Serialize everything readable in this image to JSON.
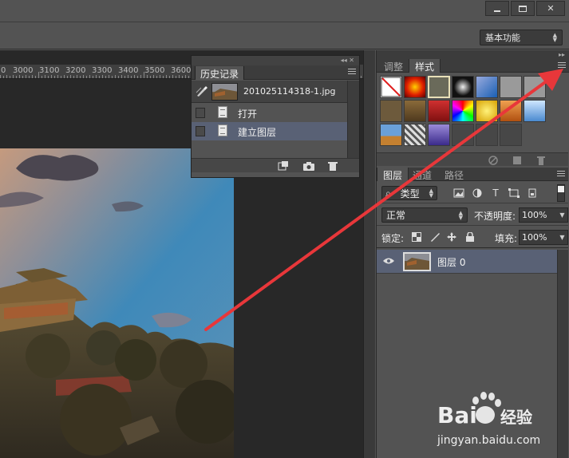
{
  "window": {
    "minimize_glyph": "minimize-icon",
    "maximize_glyph": "restore-icon",
    "close_label": "✕"
  },
  "optionsbar": {
    "workspace": "基本功能"
  },
  "ruler": {
    "labels": [
      "0",
      "3000",
      "3100",
      "3200",
      "3300",
      "3400",
      "3500",
      "3600"
    ]
  },
  "history": {
    "tab_label": "历史记录",
    "collapse_glyph": "◂◂ ✕",
    "snapshot_name": "201025114318-1.jpg",
    "rows": [
      {
        "label": "打开"
      },
      {
        "label": "建立图层"
      }
    ]
  },
  "dock": {
    "collapse_glyph": "▸▸",
    "style_tabs": [
      {
        "label": "调整"
      },
      {
        "label": "样式"
      }
    ],
    "layer_tabs": [
      {
        "label": "图层"
      },
      {
        "label": "通道"
      },
      {
        "label": "路径"
      }
    ]
  },
  "layers": {
    "filter_kind": "类型",
    "blend_mode": "正常",
    "opacity_label": "不透明度:",
    "opacity_value": "100%",
    "lock_label": "锁定:",
    "fill_label": "填充:",
    "fill_value": "100%",
    "items": [
      {
        "name": "图层 0"
      }
    ]
  },
  "watermark": {
    "brand_a": "Bai",
    "brand_b": "经验",
    "url": "jingyan.baidu.com"
  },
  "colors": {
    "accent_arrow": "#e8373a",
    "selected_row": "#596175",
    "panel_bg": "#535353"
  }
}
